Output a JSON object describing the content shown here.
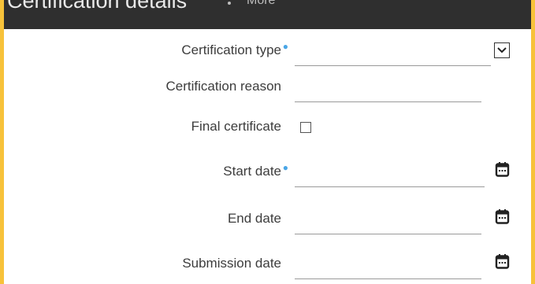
{
  "header": {
    "title": "Certification details",
    "more_label": "More"
  },
  "form": {
    "certification_type": {
      "label": "Certification type",
      "required": true,
      "value": ""
    },
    "certification_reason": {
      "label": "Certification reason",
      "value": ""
    },
    "final_certificate": {
      "label": "Final certificate",
      "checked": false
    },
    "start_date": {
      "label": "Start date",
      "required": true,
      "value": ""
    },
    "end_date": {
      "label": "End date",
      "value": ""
    },
    "submission_date": {
      "label": "Submission date",
      "value": ""
    }
  },
  "colors": {
    "border_accent": "#f7c23a",
    "header_bg": "#2f2f2f",
    "required_dot": "#4aa6e6"
  },
  "icons": [
    "chevron-down-icon",
    "calendar-icon"
  ]
}
